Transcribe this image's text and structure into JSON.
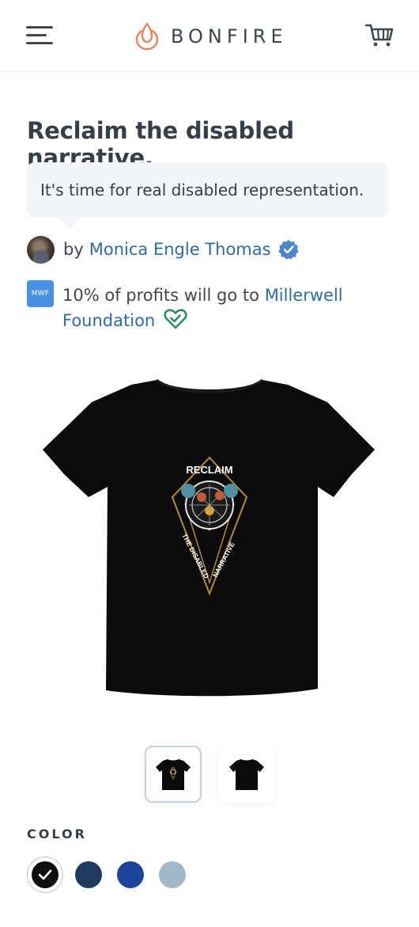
{
  "header": {
    "brand": "BONFIRE",
    "colors": {
      "brand_flame": "#e8845e"
    }
  },
  "campaign": {
    "title": "Reclaim the disabled narrative.",
    "description": "It's time for real disabled representation.",
    "by_label": "by",
    "creator_name": "Monica Engle Thomas",
    "charity_logo_text": "MWF",
    "charity_prefix": "10% of profits will go to",
    "charity_name": "Millerwell Foundation"
  },
  "product": {
    "graphic_text_top": "RECLAIM",
    "graphic_text_left": "THE DISABLED",
    "graphic_text_right": "NARRATIVE",
    "thumbnails": [
      {
        "name": "front",
        "selected": true
      },
      {
        "name": "back",
        "selected": false
      }
    ]
  },
  "color_picker": {
    "label": "COLOR",
    "swatches": [
      {
        "color": "#0e0e0e",
        "selected": true
      },
      {
        "color": "#1f3a5c",
        "selected": false
      },
      {
        "color": "#20439b",
        "selected": false
      },
      {
        "color": "#a2b8c9",
        "selected": false
      }
    ]
  },
  "icons": [
    "menu-icon",
    "bonfire-flame-icon",
    "cart-icon",
    "verified-badge-icon",
    "heart-check-icon",
    "checkmark-icon"
  ]
}
